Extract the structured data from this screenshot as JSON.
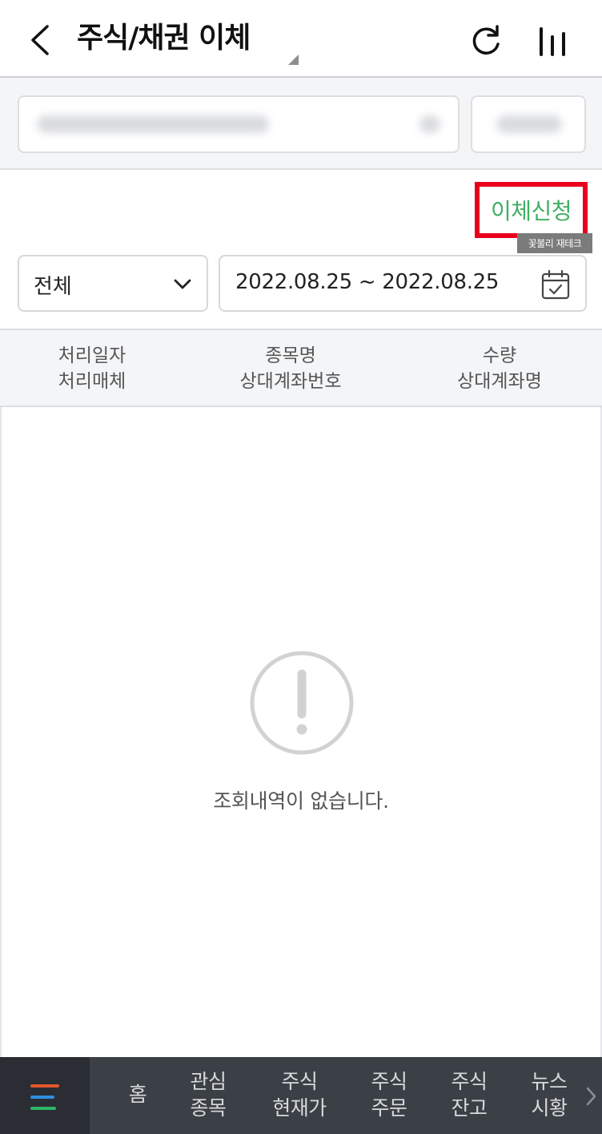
{
  "header": {
    "title": "주식/채권 이체",
    "back_icon": "chevron-left-icon",
    "refresh_icon": "refresh-icon",
    "chart_icon": "bar-chart-icon"
  },
  "actions": {
    "transfer_request_label": "이체신청",
    "watermark": "꽃불리 재테크",
    "highlight_color": "#e8001c",
    "accent_color": "#3fae62"
  },
  "filters": {
    "type_selected": "전체",
    "date_range": "2022.08.25 ~ 2022.08.25"
  },
  "table": {
    "columns": [
      {
        "line1": "처리일자",
        "line2": "처리매체"
      },
      {
        "line1": "종목명",
        "line2": "상대계좌번호"
      },
      {
        "line1": "수량",
        "line2": "상대계좌명"
      }
    ]
  },
  "empty_state": {
    "message": "조회내역이 없습니다.",
    "icon": "exclamation-circle-icon"
  },
  "bottom_nav": {
    "items": [
      {
        "line1": "홈",
        "line2": ""
      },
      {
        "line1": "관심",
        "line2": "종목"
      },
      {
        "line1": "주식",
        "line2": "현재가"
      },
      {
        "line1": "주식",
        "line2": "주문"
      },
      {
        "line1": "주식",
        "line2": "잔고"
      },
      {
        "line1": "뉴스",
        "line2": "시황"
      }
    ]
  }
}
